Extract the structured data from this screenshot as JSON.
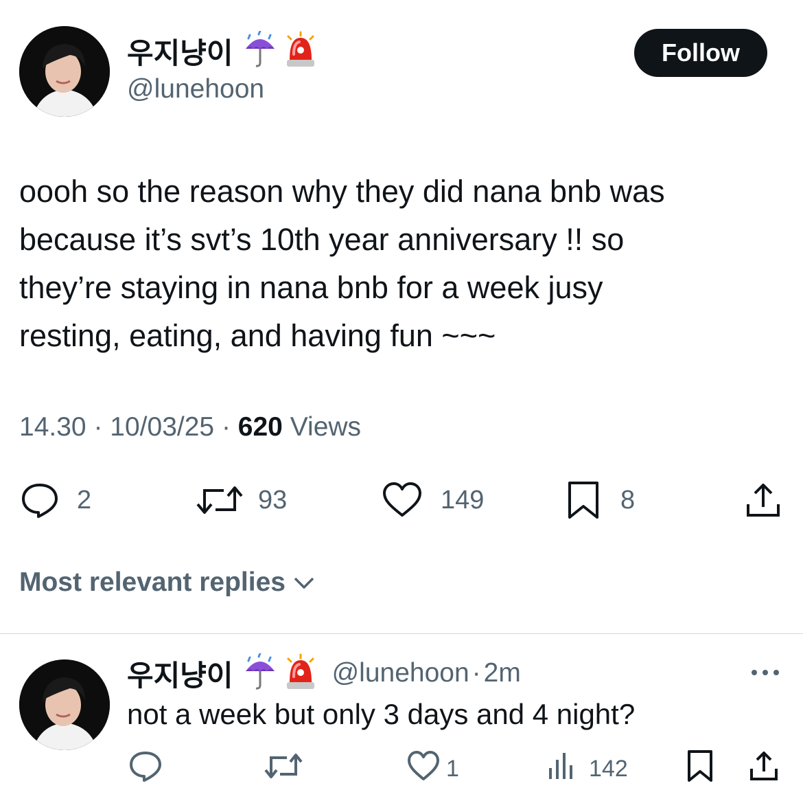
{
  "tweet": {
    "display_name": "우지냥이",
    "name_emojis": [
      "umbrella-with-rain-icon",
      "police-siren-icon"
    ],
    "handle": "@lunehoon",
    "follow_label": "Follow",
    "text_lines": [
      "oooh so the reason why they did nana bnb was",
      "because it’s svt’s 10th year anniversary !! so",
      "they’re staying in nana bnb for a week jusy",
      "resting, eating, and having fun ~~~"
    ],
    "time": "14.30",
    "separator": "·",
    "date": "10/03/25",
    "views_count": "620",
    "views_label": "Views",
    "stats": {
      "replies": "2",
      "reposts": "93",
      "likes": "149",
      "bookmarks": "8"
    }
  },
  "replies_section": {
    "label": "Most relevant replies"
  },
  "reply": {
    "display_name": "우지냥이",
    "handle": "@lunehoon",
    "separator": "·",
    "age": "2m",
    "text": "not a week but only 3 days and 4 night?",
    "stats": {
      "likes": "1",
      "views": "142"
    }
  },
  "colors": {
    "text": "#0f1419",
    "secondary": "#536471",
    "divider": "#cfd9de",
    "button": "#0f1419"
  }
}
